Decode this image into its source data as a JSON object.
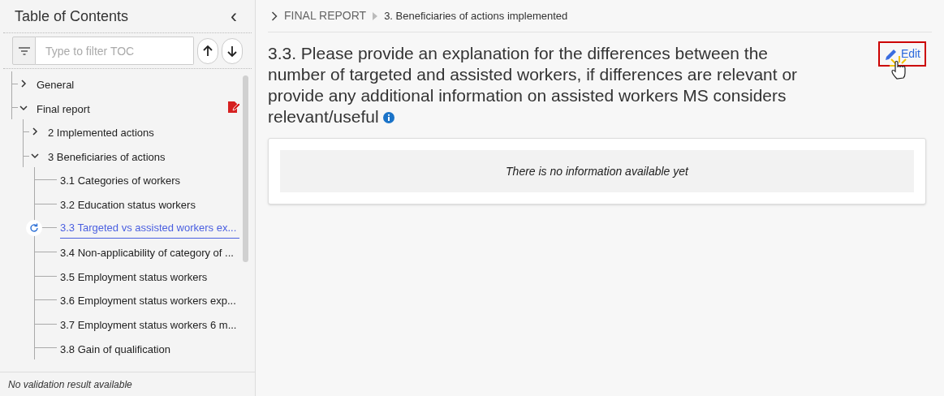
{
  "sidebar": {
    "title": "Table of Contents",
    "collapse_icon": "‹",
    "filter": {
      "placeholder": "Type to filter TOC"
    },
    "tree": [
      {
        "label": "General",
        "expanded": false,
        "edited": false,
        "selected": false
      },
      {
        "label": "Final report",
        "expanded": true,
        "edited": true,
        "selected": false,
        "children": [
          {
            "label": "2 Implemented actions",
            "expanded": false,
            "selected": false
          },
          {
            "label": "3 Beneficiaries of actions",
            "expanded": true,
            "selected": false,
            "children": [
              {
                "label": "3.1 Categories of workers",
                "selected": false
              },
              {
                "label": "3.2 Education status workers",
                "selected": false
              },
              {
                "label": "3.3 Targeted vs assisted workers ex...",
                "selected": true
              },
              {
                "label": "3.4 Non-applicability of category of ...",
                "selected": false
              },
              {
                "label": "3.5 Employment status workers",
                "selected": false
              },
              {
                "label": "3.6 Employment status workers exp...",
                "selected": false
              },
              {
                "label": "3.7 Employment status workers 6 m...",
                "selected": false
              },
              {
                "label": "3.8 Gain of qualification",
                "selected": false
              }
            ]
          }
        ]
      }
    ],
    "footer": "No validation result available"
  },
  "breadcrumb": [
    "FINAL REPORT",
    "3. Beneficiaries of actions implemented"
  ],
  "section": {
    "title": "3.3. Please provide an explanation for the differences between the number of targeted and assisted workers, if differences are relevant or provide any additional information on assisted workers MS considers relevant/useful",
    "edit_button": "Edit",
    "empty_message": "There is no information available yet"
  }
}
